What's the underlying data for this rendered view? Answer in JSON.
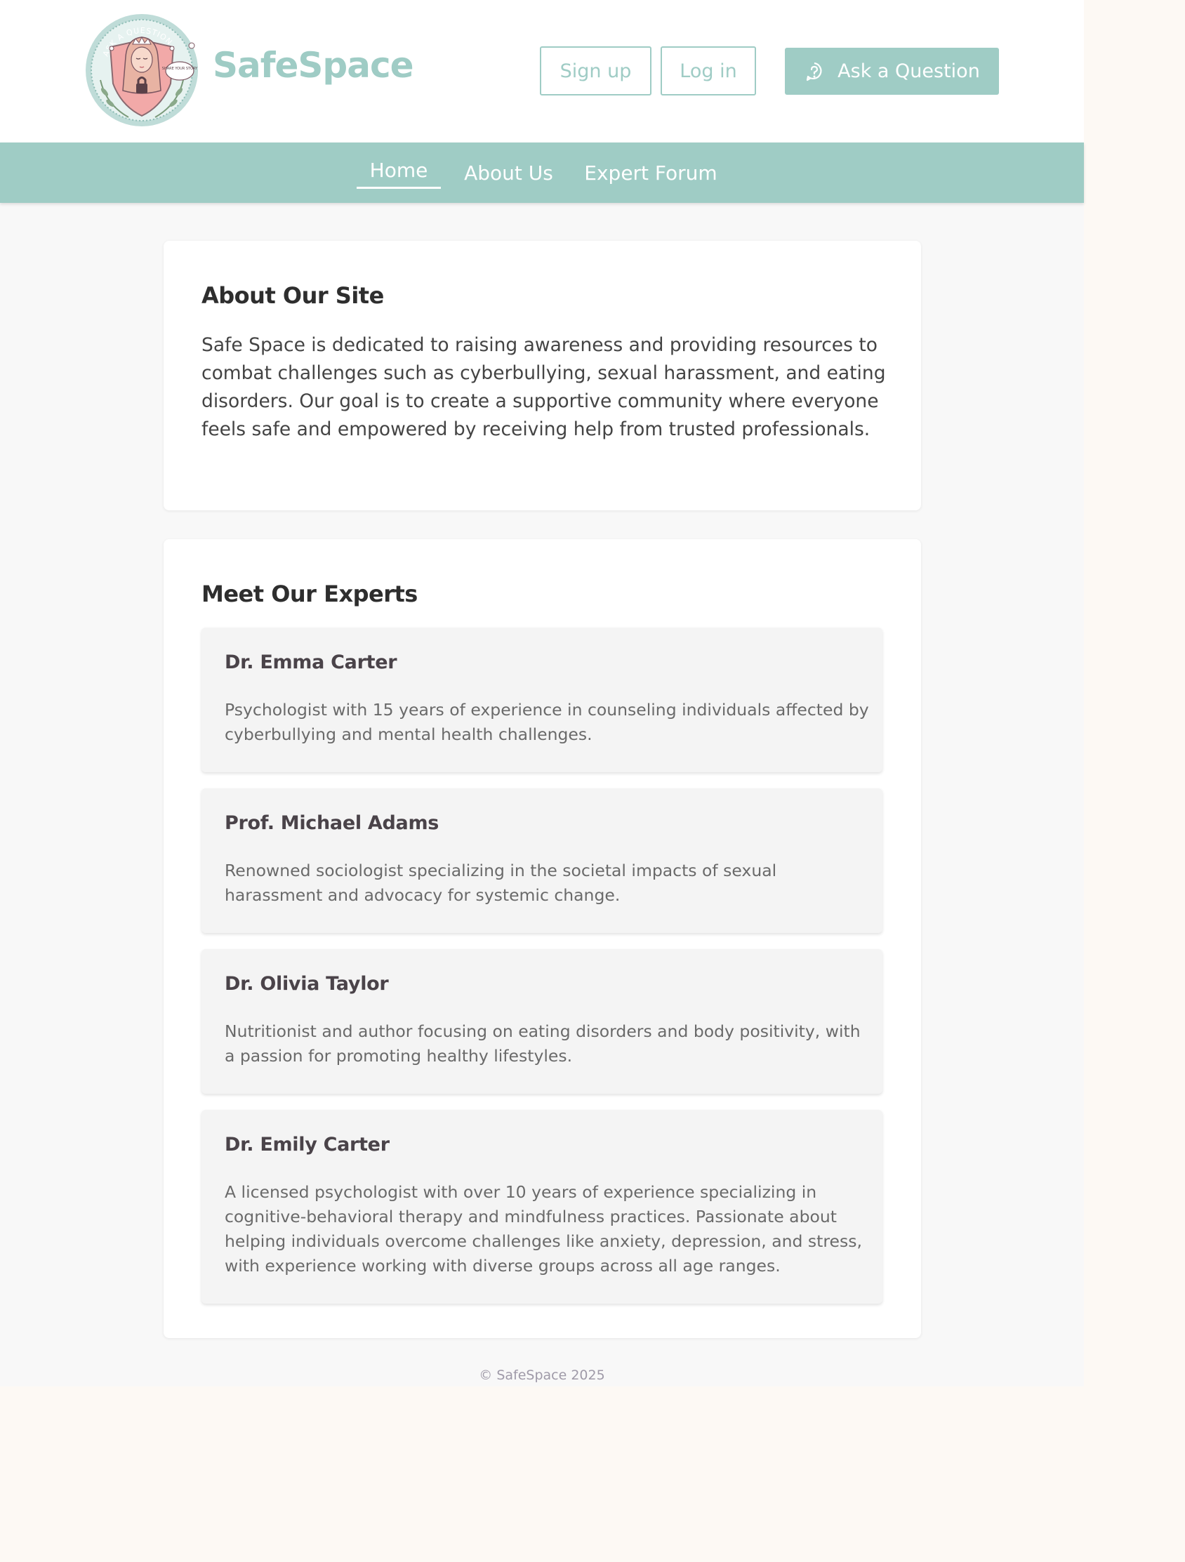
{
  "header": {
    "logo": {
      "badge_top_text": "ASK A QUESTION",
      "bubble_text": "SHARE YOUR STORY"
    },
    "brand": "SafeSpace",
    "signup_label": "Sign up",
    "login_label": "Log in",
    "ask_label": "Ask a Question",
    "ask_icon": "question-bubble-icon"
  },
  "nav": {
    "items": [
      {
        "label": "Home",
        "active": true
      },
      {
        "label": "About Us",
        "active": false
      },
      {
        "label": "Expert Forum",
        "active": false
      }
    ]
  },
  "about": {
    "title": "About Our Site",
    "text": "Safe Space is dedicated to raising awareness and providing resources to combat challenges such as cyberbullying, sexual harassment, and eating disorders. Our goal is to create a supportive community where everyone feels safe and empowered by receiving help from trusted professionals."
  },
  "experts": {
    "title": "Meet Our Experts",
    "items": [
      {
        "name": "Dr. Emma Carter",
        "bio": "Psychologist with 15 years of experience in counseling individuals affected by cyberbullying and mental health challenges."
      },
      {
        "name": "Prof. Michael Adams",
        "bio": "Renowned sociologist specializing in the societal impacts of sexual harassment and advocacy for systemic change."
      },
      {
        "name": "Dr. Olivia Taylor",
        "bio": "Nutritionist and author focusing on eating disorders and body positivity, with a passion for promoting healthy lifestyles."
      },
      {
        "name": "Dr. Emily Carter",
        "bio": "A licensed psychologist with over 10 years of experience specializing in cognitive-behavioral therapy and mindfulness practices. Passionate about helping individuals overcome challenges like anxiety, depression, and stress, with experience working with diverse groups across all age ranges."
      }
    ]
  },
  "footer": {
    "text": "© SafeSpace 2025"
  },
  "colors": {
    "accent": "#9fccc5",
    "page_bg": "#f8f8f8",
    "logo_shield": "#f2a9a8"
  }
}
